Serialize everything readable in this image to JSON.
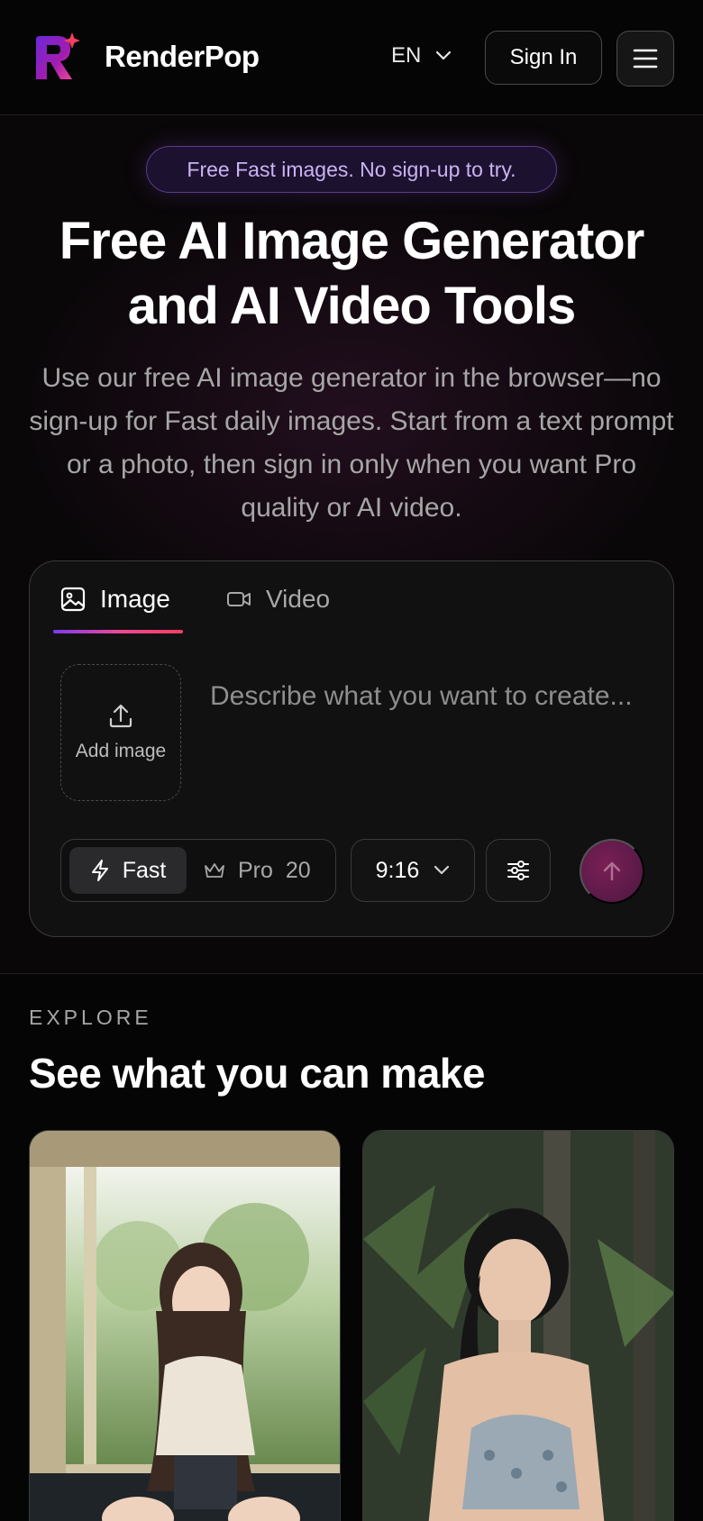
{
  "header": {
    "brand": "RenderPop",
    "language": "EN",
    "sign_in": "Sign In"
  },
  "hero": {
    "badge": "Free Fast images. No sign-up to try.",
    "title_line1": "Free AI Image Generator",
    "title_line2": "and AI Video Tools",
    "subtitle": "Use our free AI image generator in the browser—no sign-up for Fast daily images. Start from a text prompt or a photo, then sign in only when you want Pro quality or AI video."
  },
  "composer": {
    "tabs": [
      {
        "label": "Image",
        "icon": "image-icon",
        "active": true
      },
      {
        "label": "Video",
        "icon": "video-icon",
        "active": false
      }
    ],
    "add_image_label": "Add image",
    "prompt_placeholder": "Describe what you want to create...",
    "prompt_value": "",
    "modes": {
      "fast_label": "Fast",
      "pro_label": "Pro",
      "pro_cost": "20",
      "selected": "Fast"
    },
    "aspect_ratio": "9:16"
  },
  "explore": {
    "label": "EXPLORE",
    "title": "See what you can make",
    "cards": [
      {
        "kind": "photo",
        "description_icon": "gallery-photo"
      },
      {
        "kind": "photo",
        "description_icon": "gallery-photo"
      }
    ]
  },
  "colors": {
    "background": "#050505",
    "accent_purple": "#7c3aed",
    "accent_pink": "#ec4899",
    "badge_text": "#c9b3f2"
  }
}
